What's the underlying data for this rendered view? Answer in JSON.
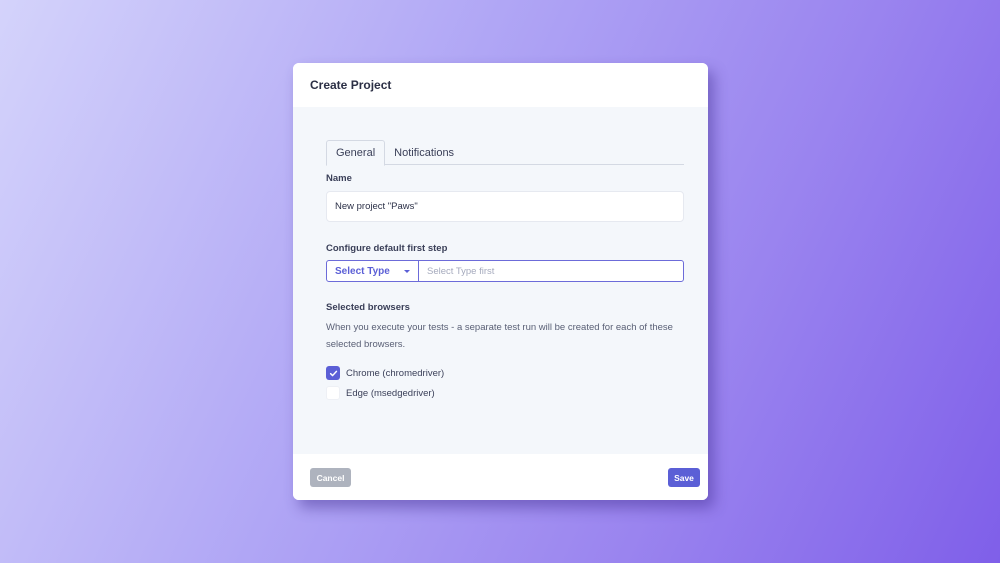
{
  "modal": {
    "title": "Create Project"
  },
  "tabs": [
    {
      "label": "General",
      "active": true
    },
    {
      "label": "Notifications",
      "active": false
    }
  ],
  "name_field": {
    "label": "Name",
    "value": "New project \"Paws\""
  },
  "first_step": {
    "label": "Configure default first step",
    "type_select_label": "Select Type",
    "input_placeholder": "Select Type first"
  },
  "browsers": {
    "label": "Selected browsers",
    "description": "When you execute your tests - a separate test run will be created for each of these selected browsers.",
    "items": [
      {
        "label": "Chrome (chromedriver)",
        "checked": true
      },
      {
        "label": "Edge (msedgedriver)",
        "checked": false
      }
    ]
  },
  "footer": {
    "cancel_label": "Cancel",
    "save_label": "Save"
  },
  "colors": {
    "accent": "#5b5fd6",
    "cancel": "#aeb3be",
    "body_bg": "#f4f7fb"
  },
  "icons": {
    "checkbox_checked": "check-icon",
    "dropdown": "caret-down-icon"
  }
}
